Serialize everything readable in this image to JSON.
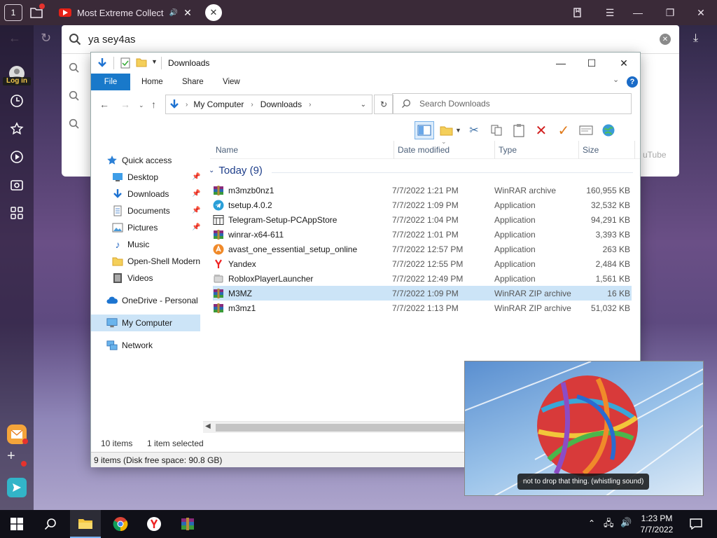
{
  "browser": {
    "tab_title": "Most Extreme Collect",
    "address_query": "ya sey4as",
    "login_label": "Log in",
    "home_tab_number": "1",
    "suggestion_youtube": "uTube"
  },
  "explorer": {
    "window_title": "Downloads",
    "ribbon_tabs": [
      "File",
      "Home",
      "Share",
      "View"
    ],
    "breadcrumb": [
      "My Computer",
      "Downloads"
    ],
    "search_placeholder": "Search Downloads",
    "columns": [
      "Name",
      "Date modified",
      "Type",
      "Size"
    ],
    "nav_pane": {
      "quick_access": "Quick access",
      "items": [
        "Desktop",
        "Downloads",
        "Documents",
        "Pictures",
        "Music",
        "Open-Shell Modern",
        "Videos"
      ],
      "onedrive": "OneDrive - Personal",
      "my_computer": "My Computer",
      "network": "Network"
    },
    "group_label": "Today (9)",
    "files": [
      {
        "name": "m3mzb0nz1",
        "date": "7/7/2022 1:21 PM",
        "type": "WinRAR archive",
        "size": "160,955 KB",
        "icon": "winrar-icon"
      },
      {
        "name": "tsetup.4.0.2",
        "date": "7/7/2022 1:09 PM",
        "type": "Application",
        "size": "32,532 KB",
        "icon": "telegram-icon"
      },
      {
        "name": "Telegram-Setup-PCAppStore",
        "date": "7/7/2022 1:04 PM",
        "type": "Application",
        "size": "94,291 KB",
        "icon": "app-window-icon"
      },
      {
        "name": "winrar-x64-611",
        "date": "7/7/2022 1:01 PM",
        "type": "Application",
        "size": "3,393 KB",
        "icon": "winrar-icon"
      },
      {
        "name": "avast_one_essential_setup_online",
        "date": "7/7/2022 12:57 PM",
        "type": "Application",
        "size": "263 KB",
        "icon": "avast-icon"
      },
      {
        "name": "Yandex",
        "date": "7/7/2022 12:55 PM",
        "type": "Application",
        "size": "2,484 KB",
        "icon": "yandex-icon"
      },
      {
        "name": "RobloxPlayerLauncher",
        "date": "7/7/2022 12:49 PM",
        "type": "Application",
        "size": "1,561 KB",
        "icon": "roblox-icon"
      },
      {
        "name": "M3MZ",
        "date": "7/7/2022 1:09 PM",
        "type": "WinRAR ZIP archive",
        "size": "16 KB",
        "icon": "winrar-icon",
        "selected": true
      },
      {
        "name": "m3mz1",
        "date": "7/7/2022 1:13 PM",
        "type": "WinRAR ZIP archive",
        "size": "51,032 KB",
        "icon": "winrar-icon"
      }
    ],
    "status_items": "10 items",
    "status_selected": "1 item selected",
    "status_disk": "9 items (Disk free space: 90.8 GB)"
  },
  "video": {
    "caption": "not to drop that thing. (whistling sound)"
  },
  "taskbar": {
    "time": "1:23 PM",
    "date": "7/7/2022"
  },
  "colors": {
    "file_tab": "#1979ca",
    "selection": "#cce4f7",
    "group_header": "#1e3e8a"
  }
}
